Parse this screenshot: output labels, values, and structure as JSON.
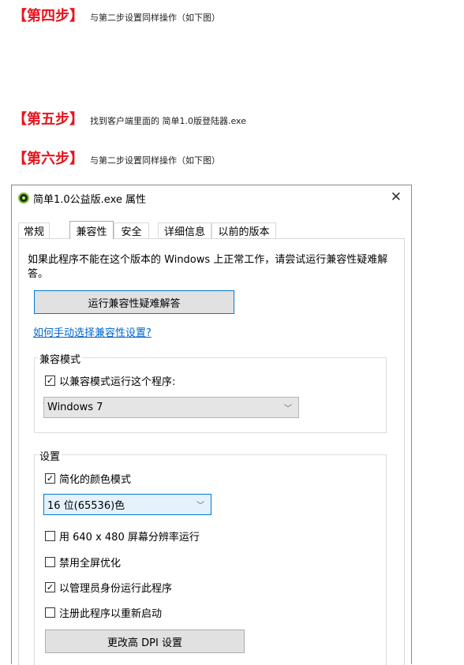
{
  "steps": [
    {
      "title": "【第四步】",
      "desc": "与第二步设置同样操作（如下图）"
    },
    {
      "title": "【第五步】",
      "desc": "找到客户端里面的 简单1.0版登陆器.exe"
    },
    {
      "title": "【第六步】",
      "desc": "与第二步设置同样操作（如下图）"
    }
  ],
  "dialog": {
    "title": "简单1.0公益版.exe 属性",
    "close": "✕",
    "tabs": [
      "常规",
      "兼容性",
      "安全",
      "详细信息",
      "以前的版本"
    ],
    "active_tab": "兼容性",
    "description": "如果此程序不能在这个版本的 Windows 上正常工作，请尝试运行兼容性疑难解答。",
    "troubleshoot_button": "运行兼容性疑难解答",
    "manual_link": "如何手动选择兼容性设置?",
    "compat_mode": {
      "group_label": "兼容模式",
      "checkbox_label": "以兼容模式运行这个程序:",
      "checked": true,
      "selected_os": "Windows 7"
    },
    "settings": {
      "group_label": "设置",
      "reduced_color": {
        "label": "简化的颜色模式",
        "checked": true
      },
      "color_option": "16 位(65536)色",
      "res640": {
        "label": "用 640 x 480 屏幕分辨率运行",
        "checked": false
      },
      "disable_fullscreen": {
        "label": "禁用全屏优化",
        "checked": false
      },
      "run_as_admin": {
        "label": "以管理员身份运行此程序",
        "checked": true
      },
      "register_restart": {
        "label": "注册此程序以重新启动",
        "checked": false
      },
      "dpi_button": "更改高 DPI 设置"
    }
  }
}
